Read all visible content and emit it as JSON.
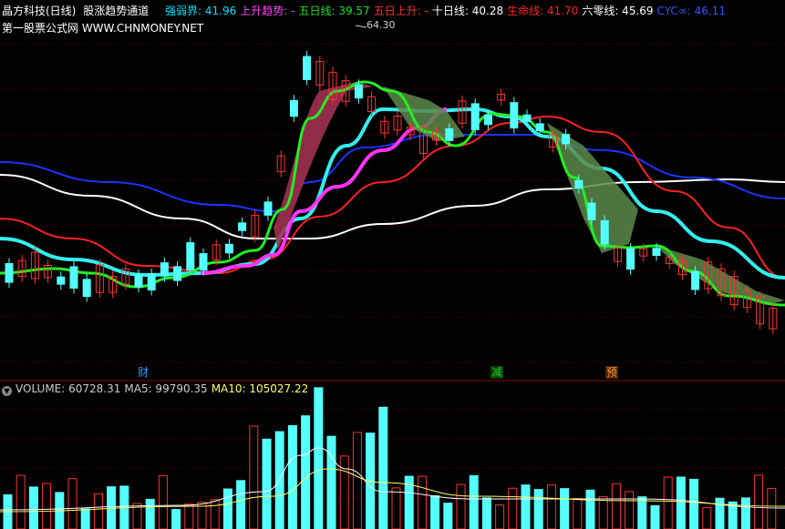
{
  "header": {
    "stock": "晶方科技(日线)",
    "indicator": "股涨趋势通道",
    "items": [
      {
        "label": "强弱界: ",
        "value": "41.96",
        "color": "#00e5ff"
      },
      {
        "label": "上升趋势: ",
        "value": "-",
        "color": "#ff44ff"
      },
      {
        "label": "五日线: ",
        "value": "39.57",
        "color": "#22dd22"
      },
      {
        "label": "五日上升: ",
        "value": "-",
        "color": "#ff3333"
      },
      {
        "label": "十日线: ",
        "value": "40.28",
        "color": "#ffffff"
      },
      {
        "label": "生命线: ",
        "value": "41.70",
        "color": "#ff2222"
      },
      {
        "label": "六零线: ",
        "value": "45.69",
        "color": "#ffffff"
      },
      {
        "label": "CYC∞: ",
        "value": "46.11",
        "color": "#3355ff"
      }
    ]
  },
  "site_text": "第一股票公式网 WWW.CHNMONEY.NET",
  "peak_label": "64.30",
  "signals": [
    {
      "text": "财",
      "color": "#3399ff"
    },
    {
      "text": "减",
      "color": "#22cc22"
    },
    {
      "text": "预",
      "color": "#ff9933"
    }
  ],
  "volume_header": {
    "items": [
      {
        "label": "VOLUME: ",
        "value": "60728.31",
        "color": "#cccccc"
      },
      {
        "label": "MA5: ",
        "value": "99790.35",
        "color": "#cccccc"
      },
      {
        "label": "MA10: ",
        "value": "105027.22",
        "color": "#ffff66"
      }
    ]
  },
  "colors": {
    "up": "#ff3232",
    "down": "#54ffff",
    "grid": "#8b0000",
    "ma60": "#ffffff",
    "cyc": "#1a33ff",
    "life": "#ff2020",
    "strong": "#33eeee",
    "rise": "#ff33ff",
    "ma5": "#22ee22",
    "fill_up": "#a03050",
    "fill_down": "#5c8a4a"
  },
  "icons": {
    "volume_toggle": "chevron-down-icon"
  }
}
